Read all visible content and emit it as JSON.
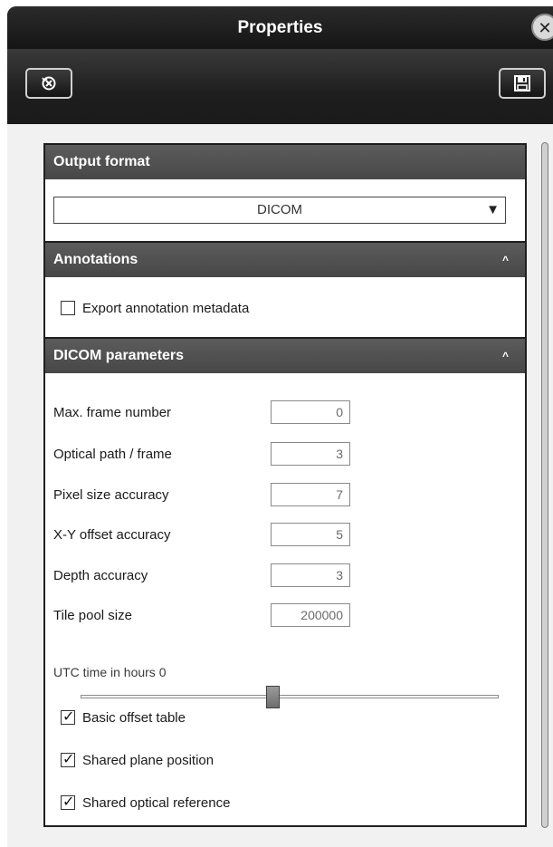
{
  "window": {
    "title": "Properties",
    "close_glyph": "✕"
  },
  "toolbar": {
    "reset_icon": "reset-icon",
    "save_icon": "save-icon"
  },
  "output_format": {
    "header": "Output format",
    "selected": "DICOM",
    "arrow": "▼"
  },
  "annotations": {
    "header": "Annotations",
    "chevron": "^",
    "export_metadata": {
      "label": "Export annotation metadata",
      "checked": false
    }
  },
  "dicom": {
    "header": "DICOM parameters",
    "chevron": "^",
    "params": [
      {
        "label": "Max. frame number",
        "value": "0"
      },
      {
        "label": "Optical path / frame",
        "value": "3"
      },
      {
        "label": "Pixel size accuracy",
        "value": "7"
      },
      {
        "label": "X-Y offset accuracy",
        "value": "5"
      },
      {
        "label": "Depth accuracy",
        "value": "3"
      },
      {
        "label": "Tile pool size",
        "value": "200000"
      }
    ],
    "utc_label": "UTC time in hours 0",
    "utc_slider_fraction": 0.5,
    "checks": [
      {
        "label": "Basic offset table",
        "checked": true
      },
      {
        "label": "Shared plane position",
        "checked": true
      },
      {
        "label": "Shared optical reference",
        "checked": true
      }
    ]
  }
}
